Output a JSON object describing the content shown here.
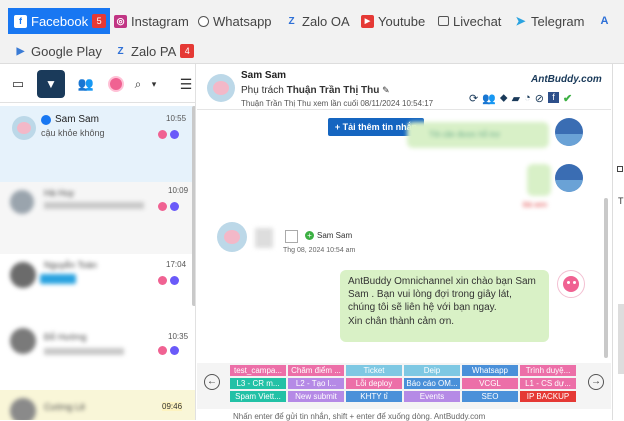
{
  "channels": {
    "facebook": {
      "label": "Facebook",
      "badge": "5"
    },
    "instagram": {
      "label": "Instagram"
    },
    "whatsapp": {
      "label": "Whatsapp"
    },
    "zalo_oa": {
      "label": "Zalo OA"
    },
    "youtube": {
      "label": "Youtube"
    },
    "livechat": {
      "label": "Livechat"
    },
    "telegram": {
      "label": "Telegram"
    },
    "google_play": {
      "label": "Google Play"
    },
    "zalo_pa": {
      "label": "Zalo PA",
      "badge": "4"
    }
  },
  "conversations": [
    {
      "name": "Sam Sam",
      "preview": "cậu khỏe không",
      "time": "10:55"
    },
    {
      "name": "Hà Huy",
      "preview": "",
      "time": "10:09"
    },
    {
      "name": "Nguyễn Toàn",
      "preview": "",
      "time": "17:04"
    },
    {
      "name": "Đỗ Hường",
      "preview": "",
      "time": "10:35"
    },
    {
      "name": "Cường Lê",
      "preview": "",
      "time": "09:46"
    }
  ],
  "chat": {
    "name": "Sam Sam",
    "assign_prefix": "Phụ trách ",
    "assignee": "Thuận Trần Thị Thu",
    "seen_note": "Thuận Trần Thị Thu xem lần cuối 08/11/2024 10:54:17",
    "brand": "AntBuddy.com",
    "load_more": "Tải thêm tin nhắn",
    "out_msg_1": "Tôi cần được hỗ trợ",
    "status_1": "Đã xem",
    "status_2": "Đã xem",
    "card_name": "Sam Sam",
    "card_time": "Thg 08, 2024 10:54 am",
    "bot_msg_1": "AntBuddy Omnichannel xin chào bạn Sam Sam . Bạn vui lòng đợi trong giây lát, chúng tôi sẽ liên hệ với bạn ngay.",
    "bot_msg_2": "Xin chân thành cảm ơn.",
    "footer_note": "Nhấn enter để gửi tin nhắn, shift + enter để xuống dòng. AntBuddy.com"
  },
  "quick_replies": [
    [
      "test_campa...",
      "Chăm điểm ...",
      "Ticket",
      "Deip",
      "Whatsapp",
      "Trình duyệ..."
    ],
    [
      "L3 - CR m...",
      "L2 - Tạo l...",
      "Lỗi deploy",
      "Báo cáo OM...",
      "VCGL",
      "L1 - CS dự..."
    ],
    [
      "Spam Viett...",
      "New submit",
      "KHTY tỉ",
      "Events",
      "SEO",
      "IP BACKUP"
    ]
  ],
  "quick_reply_colors": [
    [
      "#ec6fa8",
      "#ec6fa8",
      "#7ec8e3",
      "#7ec8e3",
      "#4a90d9",
      "#ec6fa8"
    ],
    [
      "#22c1a6",
      "#b58ae6",
      "#ec6fa8",
      "#4a90d9",
      "#ec6fa8",
      "#ec6fa8"
    ],
    [
      "#22c1a6",
      "#b58ae6",
      "#4a90d9",
      "#b58ae6",
      "#4a90d9",
      "#e53935"
    ]
  ]
}
